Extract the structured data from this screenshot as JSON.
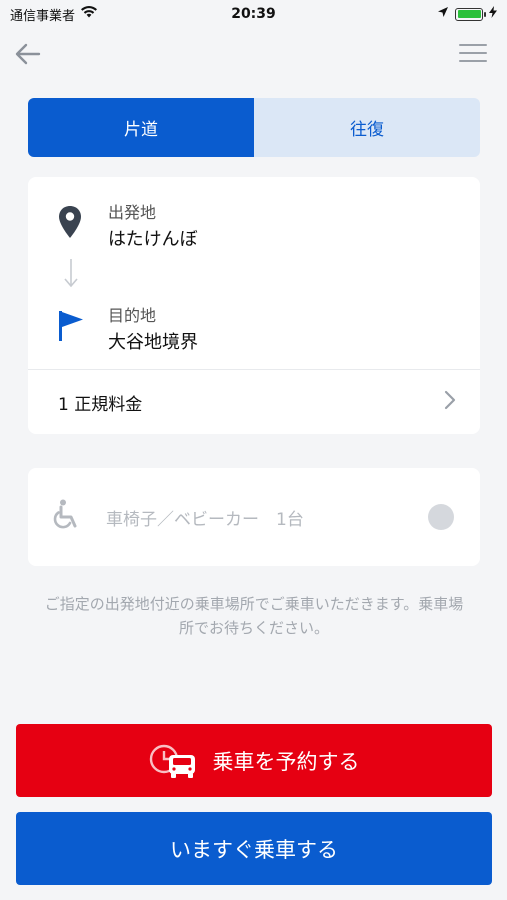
{
  "status_bar": {
    "carrier": "通信事業者",
    "time": "20:39"
  },
  "nav": {
    "back_icon": "arrow-left-icon",
    "menu_icon": "hamburger-menu-icon"
  },
  "trip_type": {
    "tabs": [
      {
        "label": "片道",
        "active": true
      },
      {
        "label": "往復",
        "active": false
      }
    ]
  },
  "route": {
    "origin": {
      "label": "出発地",
      "value": "はたけんぼ",
      "icon": "map-pin-icon"
    },
    "destination": {
      "label": "目的地",
      "value": "大谷地境界",
      "icon": "flag-icon"
    },
    "fare": "1 正規料金"
  },
  "wheelchair": {
    "label": "車椅子／ベビーカー　1台",
    "icon": "wheelchair-icon",
    "enabled": false
  },
  "notice": "ご指定の出発地付近の乗車場所でご乗車いただきます。乗車場所でお待ちください。",
  "actions": {
    "reserve_label": "乗車を予約する",
    "now_label": "いますぐ乗車する"
  },
  "colors": {
    "primary": "#0a5ccf",
    "primary_light": "#dbe7f6",
    "reserve": "#e60012",
    "background": "#f4f5f7"
  }
}
